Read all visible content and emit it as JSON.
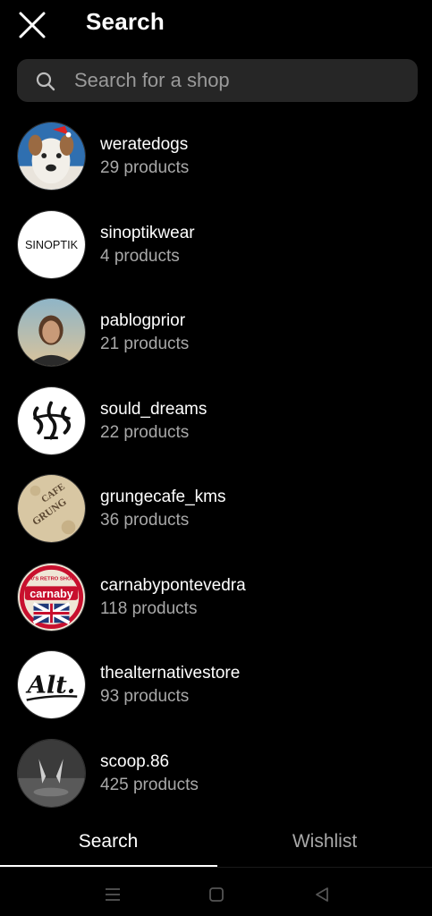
{
  "header": {
    "title": "Search"
  },
  "search": {
    "placeholder": "Search for a shop"
  },
  "shops": [
    {
      "name": "weratedogs",
      "count": "29 products",
      "avatar": "dog-photo"
    },
    {
      "name": "sinoptikwear",
      "count": "4 products",
      "avatar": "SINOPTIK"
    },
    {
      "name": "pablogprior",
      "count": "21 products",
      "avatar": "person-photo"
    },
    {
      "name": "sould_dreams",
      "count": "22 products",
      "avatar": "ink-logo"
    },
    {
      "name": "grungecafe_kms",
      "count": "36 products",
      "avatar": "grunge-logo"
    },
    {
      "name": "carnabypontevedra",
      "count": "118 products",
      "avatar": "carnaby-logo"
    },
    {
      "name": "thealternativestore",
      "count": "93 products",
      "avatar": "alt-logo"
    },
    {
      "name": "scoop.86",
      "count": "425 products",
      "avatar": "scoop-photo"
    }
  ],
  "tabs": {
    "search": "Search",
    "wishlist": "Wishlist"
  },
  "avatar_text": {
    "sinoptik": "SINOPTIK",
    "carnaby": "carnaby",
    "carnaby_top": "60'S RETRO SHOP",
    "alt": "Alt.",
    "grunge_top": "CAFE",
    "grunge_bottom": "GRUNG"
  },
  "colors": {
    "background": "#000000",
    "search_bg": "#262626",
    "secondary_text": "#a8a8a8",
    "carnaby_red": "#c8102e"
  },
  "icons": {
    "close": "close-icon",
    "search": "search-icon",
    "nav_menu": "menu-icon",
    "nav_home": "square-icon",
    "nav_back": "back-triangle-icon"
  }
}
